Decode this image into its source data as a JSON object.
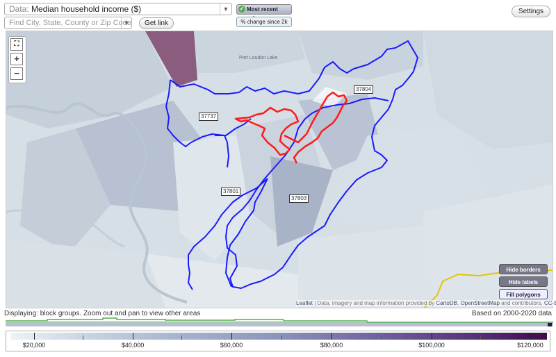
{
  "toolbar": {
    "data_label": "Data:",
    "data_value": "Median household income ($)",
    "search_placeholder": "Find City, State, County or Zip Code",
    "get_link": "Get link",
    "settings": "Settings",
    "most_recent": "Most recent value",
    "pct_change": "% change since 2k"
  },
  "map": {
    "zoom_in": "+",
    "zoom_out": "−",
    "fullscreen_icon": "fullscreen-icon",
    "zip_labels": [
      "37737",
      "37804",
      "37801",
      "37803"
    ],
    "place_label": "Port Loudon Lake",
    "buttons": {
      "hide_borders": "Hide borders",
      "hide_labels": "Hide labels",
      "fill_polygons": "Fill polygons"
    },
    "attribution": {
      "leaflet": "Leaflet",
      "text1": " | Data, imagery and map information provided by ",
      "carto": "CartoDB",
      "sep": ", ",
      "osm": "OpenStreetMap",
      "text2": " and contributors, ",
      "license": "CC-BY-SA"
    },
    "colors": {
      "boundary": "#1a1aff",
      "highlight": "#ff1a1a",
      "road": "#e6c200"
    }
  },
  "status": {
    "displaying": "Displaying: block groups. Zoom out and pan to view other areas",
    "based_on": "Based on 2000-2020 data"
  },
  "legend": {
    "ticks": [
      "$20,000",
      "$40,000",
      "$60,000",
      "$80,000",
      "$100,000",
      "$120,000"
    ],
    "colors": [
      "#edf2f6",
      "#a9b6cf",
      "#6c5e9b",
      "#3f0a4a"
    ]
  }
}
